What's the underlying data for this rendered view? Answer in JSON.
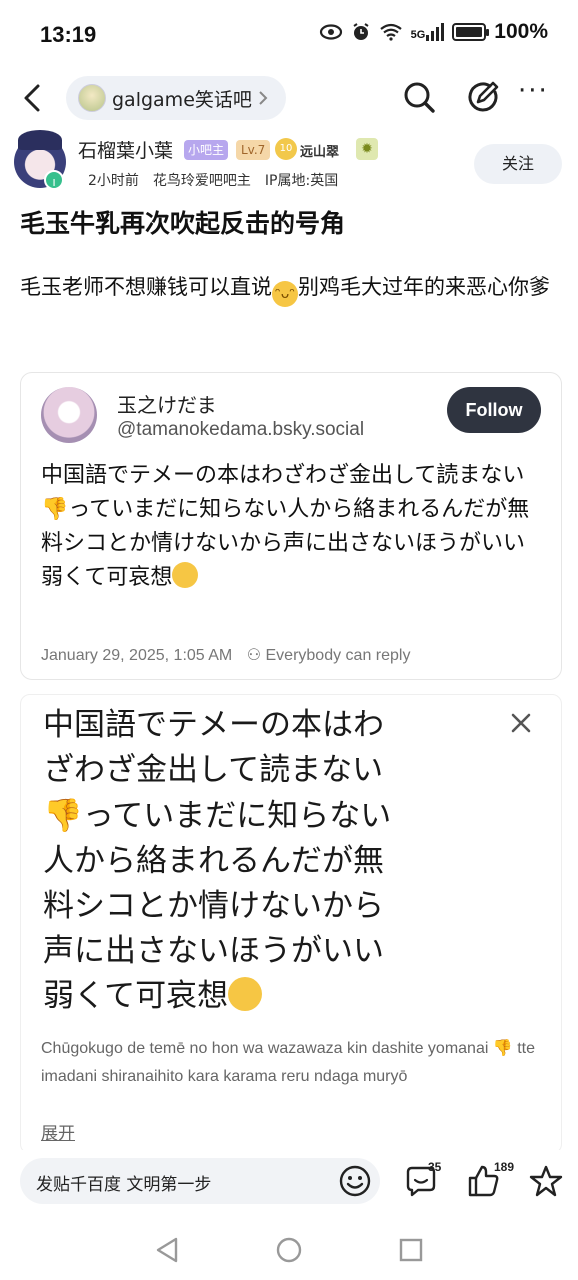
{
  "status_bar": {
    "time": "13:19",
    "network": "5G",
    "battery_percent": "100%",
    "battery_level": 1.0
  },
  "nav": {
    "forum_name": "galgame笑话吧",
    "icons": [
      "back-icon",
      "search-icon",
      "edit-icon",
      "more-icon"
    ]
  },
  "author": {
    "name": "石榴葉小葉",
    "badge_mod": "小吧主",
    "badge_level": "Lv.7",
    "badge_heart_level": "10",
    "badge_title": "远山翠",
    "time_ago": "2小时前",
    "role": "花鸟玲爱吧吧主",
    "ip": "IP属地:英国",
    "follow_label": "关注"
  },
  "post": {
    "title": "毛玉牛乳再次吹起反击的号角",
    "body_part1": "毛玉老师不想赚钱可以直说",
    "body_part2": "别鸡毛大过年的来恶心你爹"
  },
  "embed": {
    "name": "玉之けだま",
    "handle": "@tamanokedama.bsky.social",
    "follow_label": "Follow",
    "text_part1": "中国語でテメーの本はわざわざ金出して読まない",
    "text_part2": "っていまだに知らない人から絡まれるんだが無料シコとか情けないから声に出さないほうがいい　弱くて可哀想",
    "date": "January 29, 2025, 1:05 AM",
    "reply_setting": "Everybody can reply"
  },
  "translation_card": {
    "line1": "中国語でテメーの本はわ",
    "line2": "ざわざ金出して読まない",
    "line3": "っていまだに知らない",
    "line4": "人から絡まれるんだが無",
    "line5": "料シコとか情けないから",
    "line6": "声に出さないほうがいい",
    "line7": "弱くて可哀想",
    "romaji_part1": "Chūgokugo de temē no hon wa wazawaza kin dashite yomanai",
    "romaji_part2": "tte imadani shiranaihito kara karama reru ndaga muryō",
    "expand_label": "展开"
  },
  "bottom_bar": {
    "compose_placeholder": "发贴千百度 文明第一步",
    "comment_count": "35",
    "like_count": "189"
  },
  "colors": {
    "pill_bg": "#eef1f6",
    "follow_dark": "#2f3440",
    "mod_badge": "#b7a7ee",
    "level_badge": "#f5d7a8",
    "emoji_yellow": "#f6c644"
  }
}
